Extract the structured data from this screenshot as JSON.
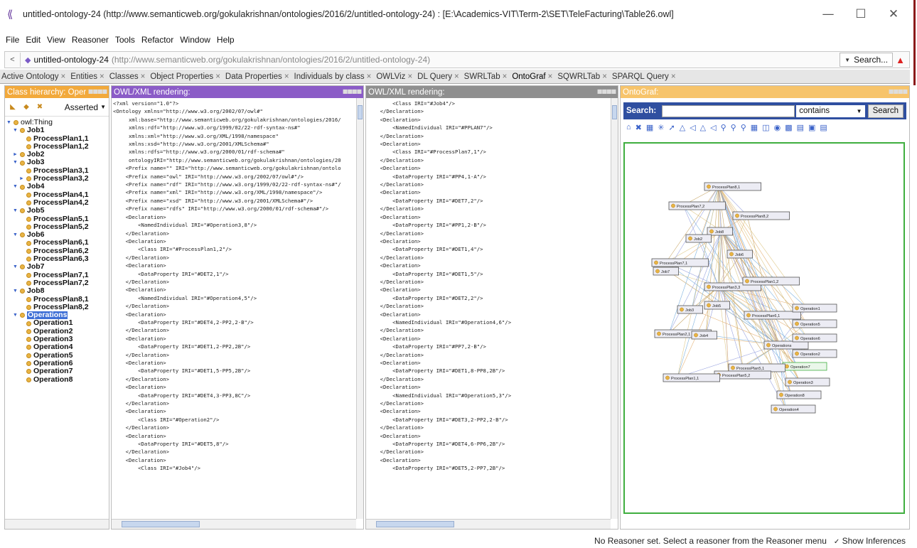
{
  "window": {
    "title": "untitled-ontology-24 (http://www.semanticweb.org/gokulakrishnan/ontologies/2016/2/untitled-ontology-24)  : [E:\\Academics-VIT\\Term-2\\SET\\TeleFacturing\\Table26.owl]",
    "minimize": "—",
    "maximize": "☐",
    "close": "✕",
    "app_icon": "protege-icon"
  },
  "menu": [
    "File",
    "Edit",
    "View",
    "Reasoner",
    "Tools",
    "Refactor",
    "Window",
    "Help"
  ],
  "address": {
    "back": "<",
    "ontology_name": "untitled-ontology-24",
    "ontology_iri": "(http://www.semanticweb.org/gokulakrishnan/ontologies/2016/2/untitled-ontology-24)",
    "search_label": "Search...",
    "warning_icon": "▲"
  },
  "tabs": [
    "Active Ontology",
    "Entities",
    "Classes",
    "Object Properties",
    "Data Properties",
    "Individuals by class",
    "OWLViz",
    "DL Query",
    "SWRLTab",
    "OntoGraf",
    "SQWRLTab",
    "SPARQL Query"
  ],
  "active_tab": "OntoGraf",
  "tab_close": "×",
  "class_panel": {
    "header": "Class hierarchy: Oper",
    "mode": "Asserted",
    "tree": [
      {
        "label": "owl:Thing",
        "level": 0,
        "toggle": "▼",
        "kind": "thing"
      },
      {
        "label": "Job1",
        "level": 1,
        "toggle": "▼"
      },
      {
        "label": "ProcessPlan1,1",
        "level": 2,
        "toggle": ""
      },
      {
        "label": "ProcessPlan1,2",
        "level": 2,
        "toggle": ""
      },
      {
        "label": "Job2",
        "level": 1,
        "toggle": "►"
      },
      {
        "label": "Job3",
        "level": 1,
        "toggle": "▼"
      },
      {
        "label": "ProcessPlan3,1",
        "level": 2,
        "toggle": ""
      },
      {
        "label": "ProcessPlan3,2",
        "level": 2,
        "toggle": "►"
      },
      {
        "label": "Job4",
        "level": 1,
        "toggle": "▼"
      },
      {
        "label": "ProcessPlan4,1",
        "level": 2,
        "toggle": ""
      },
      {
        "label": "ProcessPlan4,2",
        "level": 2,
        "toggle": ""
      },
      {
        "label": "Job5",
        "level": 1,
        "toggle": "▼"
      },
      {
        "label": "ProcessPlan5,1",
        "level": 2,
        "toggle": ""
      },
      {
        "label": "ProcessPlan5,2",
        "level": 2,
        "toggle": ""
      },
      {
        "label": "Job6",
        "level": 1,
        "toggle": "▼"
      },
      {
        "label": "ProcessPlan6,1",
        "level": 2,
        "toggle": ""
      },
      {
        "label": "ProcessPlan6,2",
        "level": 2,
        "toggle": ""
      },
      {
        "label": "ProcessPlan6,3",
        "level": 2,
        "toggle": ""
      },
      {
        "label": "Job7",
        "level": 1,
        "toggle": "▼"
      },
      {
        "label": "ProcessPlan7,1",
        "level": 2,
        "toggle": ""
      },
      {
        "label": "ProcessPlan7,2",
        "level": 2,
        "toggle": ""
      },
      {
        "label": "Job8",
        "level": 1,
        "toggle": "▼"
      },
      {
        "label": "ProcessPlan8,1",
        "level": 2,
        "toggle": ""
      },
      {
        "label": "ProcessPlan8,2",
        "level": 2,
        "toggle": ""
      },
      {
        "label": "Operations",
        "level": 1,
        "toggle": "▼",
        "selected": true
      },
      {
        "label": "Operation1",
        "level": 2,
        "toggle": ""
      },
      {
        "label": "Operation2",
        "level": 2,
        "toggle": ""
      },
      {
        "label": "Operation3",
        "level": 2,
        "toggle": ""
      },
      {
        "label": "Operation4",
        "level": 2,
        "toggle": ""
      },
      {
        "label": "Operation5",
        "level": 2,
        "toggle": ""
      },
      {
        "label": "Operation6",
        "level": 2,
        "toggle": ""
      },
      {
        "label": "Operation7",
        "level": 2,
        "toggle": ""
      },
      {
        "label": "Operation8",
        "level": 2,
        "toggle": ""
      }
    ]
  },
  "owl_panel_1": {
    "header": "OWL/XML rendering:",
    "lines": [
      "<?xml version=\"1.0\"?>",
      "<Ontology xmlns=\"http://www.w3.org/2002/07/owl#\"",
      "     xml:base=\"http://www.semanticweb.org/gokulakrishnan/ontologies/2016/",
      "     xmlns:rdf=\"http://www.w3.org/1999/02/22-rdf-syntax-ns#\"",
      "     xmlns:xml=\"http://www.w3.org/XML/1998/namespace\"",
      "     xmlns:xsd=\"http://www.w3.org/2001/XMLSchema#\"",
      "     xmlns:rdfs=\"http://www.w3.org/2000/01/rdf-schema#\"",
      "     ontologyIRI=\"http://www.semanticweb.org/gokulakrishnan/ontologies/20",
      "    <Prefix name=\"\" IRI=\"http://www.semanticweb.org/gokulakrishnan/ontolo",
      "    <Prefix name=\"owl\" IRI=\"http://www.w3.org/2002/07/owl#\"/>",
      "    <Prefix name=\"rdf\" IRI=\"http://www.w3.org/1999/02/22-rdf-syntax-ns#\"/",
      "    <Prefix name=\"xml\" IRI=\"http://www.w3.org/XML/1998/namespace\"/>",
      "    <Prefix name=\"xsd\" IRI=\"http://www.w3.org/2001/XMLSchema#\"/>",
      "    <Prefix name=\"rdfs\" IRI=\"http://www.w3.org/2000/01/rdf-schema#\"/>",
      "    <Declaration>",
      "        <NamedIndividual IRI=\"#Operation3,8\"/>",
      "    </Declaration>",
      "    <Declaration>",
      "        <Class IRI=\"#ProcessPlan1,2\"/>",
      "    </Declaration>",
      "    <Declaration>",
      "        <DataProperty IRI=\"#DET2,1\"/>",
      "    </Declaration>",
      "    <Declaration>",
      "        <NamedIndividual IRI=\"#Operation4,5\"/>",
      "    </Declaration>",
      "    <Declaration>",
      "        <DataProperty IRI=\"#DET4,2-PP2,2-B\"/>",
      "    </Declaration>",
      "    <Declaration>",
      "        <DataProperty IRI=\"#DET1,2-PP2,2B\"/>",
      "    </Declaration>",
      "    <Declaration>",
      "        <DataProperty IRI=\"#DET1,5-PP5,2B\"/>",
      "    </Declaration>",
      "    <Declaration>",
      "        <DataProperty IRI=\"#DET4,3-PP3,8C\"/>",
      "    </Declaration>",
      "    <Declaration>",
      "        <Class IRI=\"#Operation2\"/>",
      "    </Declaration>",
      "    <Declaration>",
      "        <DataProperty IRI=\"#DET5,8\"/>",
      "    </Declaration>",
      "    <Declaration>",
      "        <Class IRI=\"#Job4\"/>"
    ]
  },
  "owl_panel_2": {
    "header": "OWL/XML rendering:",
    "lines": [
      "        <Class IRI=\"#Job4\"/>",
      "    </Declaration>",
      "    <Declaration>",
      "        <NamedIndividual IRI=\"#PPLAN7\"/>",
      "    </Declaration>",
      "    <Declaration>",
      "        <Class IRI=\"#ProcessPlan7,1\"/>",
      "    </Declaration>",
      "    <Declaration>",
      "        <DataProperty IRI=\"#PP4,1-A\"/>",
      "    </Declaration>",
      "    <Declaration>",
      "        <DataProperty IRI=\"#DET7,2\"/>",
      "    </Declaration>",
      "    <Declaration>",
      "        <DataProperty IRI=\"#PP1,2-B\"/>",
      "    </Declaration>",
      "    <Declaration>",
      "        <DataProperty IRI=\"#DET1,4\"/>",
      "    </Declaration>",
      "    <Declaration>",
      "        <DataProperty IRI=\"#DET1,5\"/>",
      "    </Declaration>",
      "    <Declaration>",
      "        <DataProperty IRI=\"#DET2,2\"/>",
      "    </Declaration>",
      "    <Declaration>",
      "        <NamedIndividual IRI=\"#Operation4,6\"/>",
      "    </Declaration>",
      "    <Declaration>",
      "        <DataProperty IRI=\"#PP7,2-B\"/>",
      "    </Declaration>",
      "    <Declaration>",
      "        <DataProperty IRI=\"#DET1,8-PP8,2B\"/>",
      "    </Declaration>",
      "    <Declaration>",
      "        <NamedIndividual IRI=\"#Operation5,3\"/>",
      "    </Declaration>",
      "    <Declaration>",
      "        <DataProperty IRI=\"#DET3,2-PP2,2-B\"/>",
      "    </Declaration>",
      "    <Declaration>",
      "        <DataProperty IRI=\"#DET4,6-PP6,2B\"/>",
      "    </Declaration>",
      "    <Declaration>",
      "        <DataProperty IRI=\"#DET5,2-PP7,2B\"/>"
    ]
  },
  "ontograf": {
    "header": "OntoGraf:",
    "search_label": "Search:",
    "search_value": "",
    "match_mode": "contains",
    "search_button": "Search",
    "nodes": [
      {
        "label": "ProcessPlan8,1",
        "kind": "class"
      },
      {
        "label": "ProcessPlan7,2",
        "kind": "class"
      },
      {
        "label": "ProcessPlan8,2",
        "kind": "class"
      },
      {
        "label": "Job8",
        "kind": "class"
      },
      {
        "label": "Job2",
        "kind": "class"
      },
      {
        "label": "Job6",
        "kind": "class"
      },
      {
        "label": "ProcessPlan7,1",
        "kind": "class"
      },
      {
        "label": "Job7",
        "kind": "class"
      },
      {
        "label": "ProcessPlan3,3",
        "kind": "class"
      },
      {
        "label": "ProcessPlan1,2",
        "kind": "class"
      },
      {
        "label": "Job3",
        "kind": "class"
      },
      {
        "label": "Job5",
        "kind": "class"
      },
      {
        "label": "ProcessPlan6,1",
        "kind": "class"
      },
      {
        "label": "Operation1",
        "kind": "class"
      },
      {
        "label": "Operation5",
        "kind": "class"
      },
      {
        "label": "ProcessPlan2,1",
        "kind": "class"
      },
      {
        "label": "Job4",
        "kind": "class"
      },
      {
        "label": "Operations",
        "kind": "class"
      },
      {
        "label": "Operation6",
        "kind": "class"
      },
      {
        "label": "Operation2",
        "kind": "class"
      },
      {
        "label": "Operation7",
        "kind": "class",
        "highlight": true
      },
      {
        "label": "ProcessPlan5,1",
        "kind": "class"
      },
      {
        "label": "ProcessPlan5,2",
        "kind": "class"
      },
      {
        "label": "ProcessPlan1,1",
        "kind": "class"
      },
      {
        "label": "Operation3",
        "kind": "class"
      },
      {
        "label": "Operation8",
        "kind": "class"
      },
      {
        "label": "Operation4",
        "kind": "class"
      }
    ]
  },
  "status": {
    "message": "No Reasoner set. Select a reasoner from the Reasoner menu",
    "show_inferences": "Show Inferences",
    "checked": true
  }
}
